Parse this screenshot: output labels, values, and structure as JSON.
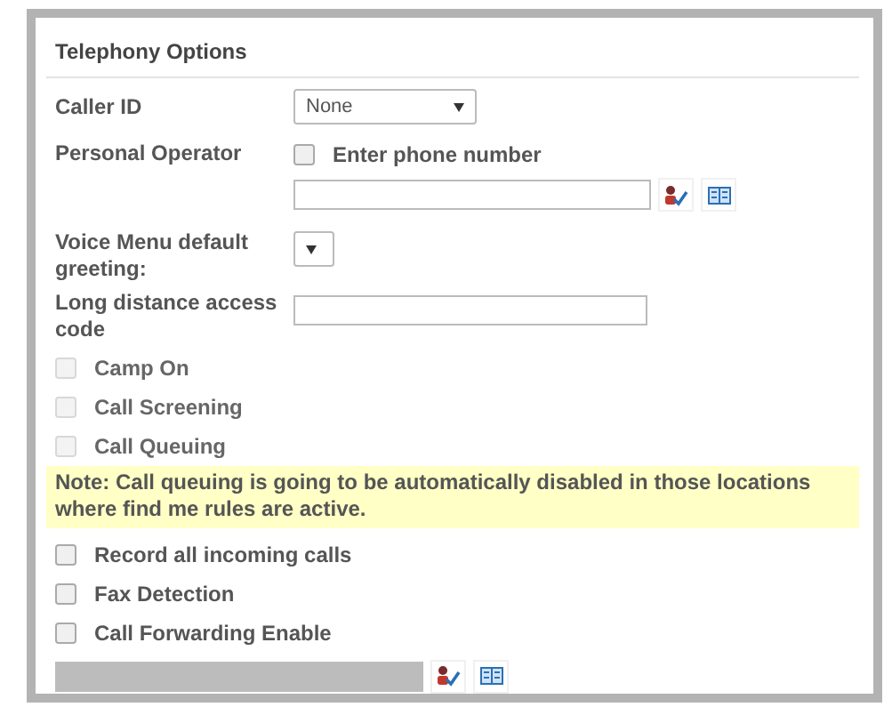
{
  "title": "Telephony Options",
  "rows": [
    {
      "kind": "select",
      "label": "Caller ID",
      "value": "None"
    },
    {
      "kind": "checkbox-field",
      "label": "Personal Operator",
      "checkbox": {
        "label": "Enter phone number",
        "checked": false
      }
    },
    {
      "kind": "lookup",
      "disabled": false
    },
    {
      "kind": "select",
      "label": "Voice Menu default greeting:"
    },
    {
      "kind": "text",
      "label": "Long distance access code"
    },
    {
      "kind": "checkbox",
      "label": "Camp On",
      "checked": false,
      "disabled": true
    },
    {
      "kind": "checkbox",
      "label": "Call Screening",
      "checked": false,
      "disabled": true
    },
    {
      "kind": "checkbox",
      "label": "Call Queuing",
      "checked": false,
      "disabled": true
    },
    {
      "kind": "note",
      "text": "Note: Call queuing is going to be automatically disabled in those locations where find me rules are active."
    },
    {
      "kind": "checkbox",
      "label": "Record all incoming calls",
      "checked": false,
      "disabled": false
    },
    {
      "kind": "checkbox",
      "label": "Fax Detection",
      "checked": false,
      "disabled": false
    },
    {
      "kind": "checkbox",
      "label": "Call Forwarding Enable",
      "checked": false,
      "disabled": false
    },
    {
      "kind": "lookup",
      "disabled": true
    }
  ]
}
